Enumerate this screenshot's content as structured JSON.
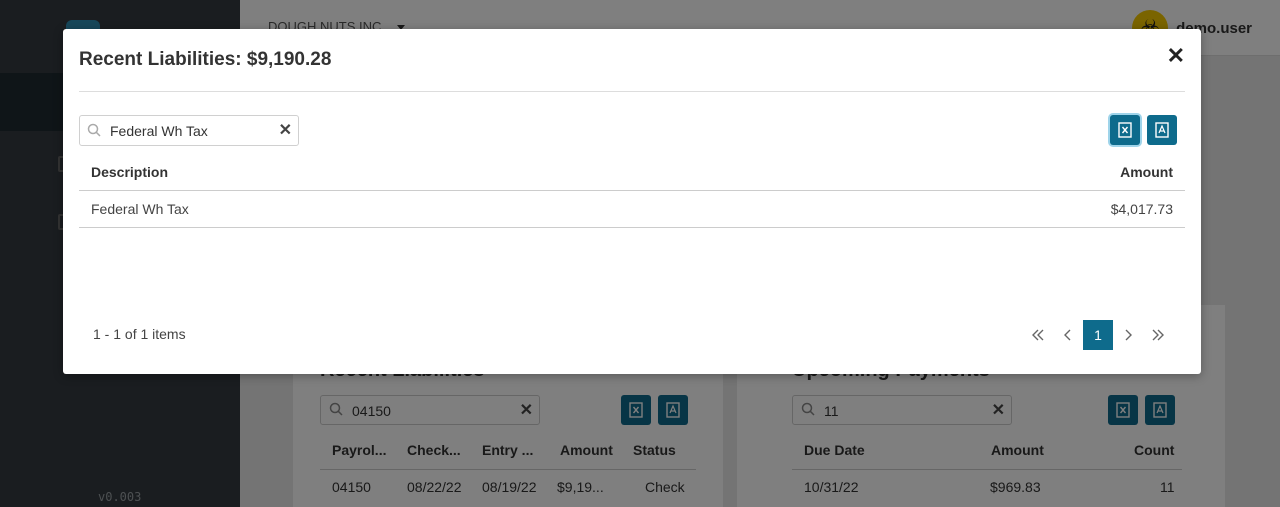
{
  "app": {
    "company": "DOUGH NUTS INC.",
    "user": "demo.user",
    "version": "v0.003"
  },
  "background": {
    "liabilities": {
      "title": "Recent Liabilities",
      "search_value": "04150",
      "columns": [
        "Payrol...",
        "Check...",
        "Entry ...",
        "Amount",
        "Status"
      ],
      "row": [
        "04150",
        "08/22/22",
        "08/19/22",
        "$9,19...",
        "Check"
      ]
    },
    "payments": {
      "title": "Upcoming Payments",
      "search_value": "11",
      "columns": [
        "Due Date",
        "Amount",
        "Count"
      ],
      "row": [
        "10/31/22",
        "$969.83",
        "11"
      ]
    }
  },
  "modal": {
    "title": "Recent Liabilities: $9,190.28",
    "search_value": "Federal Wh Tax",
    "columns": {
      "description": "Description",
      "amount": "Amount"
    },
    "rows": [
      {
        "description": "Federal Wh Tax",
        "amount": "$4,017.73"
      }
    ],
    "pager": {
      "info": "1 - 1 of 1 items",
      "current_page": "1"
    }
  },
  "colors": {
    "accent": "#0e6b8c",
    "sidebar": "#343a40",
    "overlay": "rgba(0,0,0,0.5)"
  },
  "icons": {
    "excel": "excel-export-icon",
    "pdf": "pdf-export-icon",
    "search": "search-icon",
    "clear": "clear-icon",
    "close": "close-icon"
  }
}
